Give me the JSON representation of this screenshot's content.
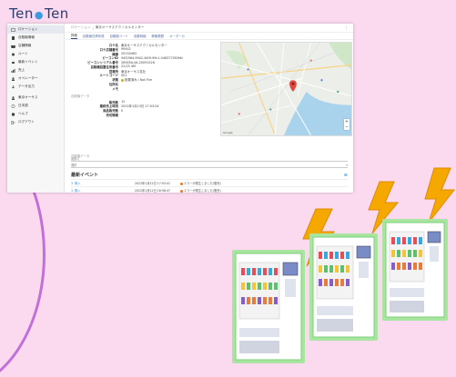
{
  "brand": {
    "logo_left": "Ten",
    "logo_dot": "●",
    "logo_right": "Ten"
  },
  "sidebar": {
    "items": [
      {
        "label": "ロケーション",
        "icon": "building-icon",
        "active": true
      },
      {
        "label": "自販機情報",
        "icon": "vending-icon"
      },
      {
        "label": "店舗情報",
        "icon": "store-icon"
      },
      {
        "label": "ルート",
        "icon": "route-icon"
      },
      {
        "label": "最新イベント",
        "icon": "bell-icon"
      },
      {
        "label": "売上",
        "icon": "chart-icon"
      },
      {
        "label": "オペレーター",
        "icon": "user-icon"
      },
      {
        "label": "データ出力",
        "icon": "download-icon"
      },
      {
        "label": "東京オーサス",
        "icon": "person-icon"
      },
      {
        "label": "日本語",
        "icon": "globe-icon"
      },
      {
        "label": "ヘルプ",
        "icon": "help-icon"
      },
      {
        "label": "ログアウト",
        "icon": "logout-icon"
      }
    ]
  },
  "topbar": {
    "crumb": "ロケーション",
    "current": "東京オーサステクニカルセンター",
    "more": "⋮"
  },
  "tabs": [
    "詳細",
    "自販機在庫状態",
    "自販機コード",
    "収集明細",
    "稼働履歴",
    "オーダーカ"
  ],
  "details": [
    {
      "k": "ロケ名",
      "v": "東京オーサステクニカルセンター"
    },
    {
      "k": "ロケ店舗番号",
      "v": "99442"
    },
    {
      "k": "機番",
      "v": "20154462"
    },
    {
      "k": "ビーコンID",
      "v": "94f2984-9942-44f9-99c1-0463770f296c"
    },
    {
      "k": "ビーコンシリアル番号",
      "v": "285EEA-VA-20091526"
    },
    {
      "k": "自販機設置住所番号",
      "v": "22/25 4M"
    },
    {
      "k": "営業所",
      "v": "東京オーサス支社"
    },
    {
      "k": "ルートコード",
      "v": "001"
    },
    {
      "k": "状態",
      "v": "設置済み / Not Fire"
    },
    {
      "k": "住所名",
      "v": ""
    },
    {
      "k": "メモ",
      "v": ""
    }
  ],
  "section2_label": "自販機データ",
  "details2": [
    {
      "k": "販売数",
      "v": "12"
    },
    {
      "k": "最終売上時刻",
      "v": "2022年1月13日 17:03:24"
    },
    {
      "k": "商品販売数",
      "v": "0"
    },
    {
      "k": "売切情報",
      "v": ""
    }
  ],
  "select_label": "自販機データ",
  "select_value": "品揃え",
  "select_value2": "選択",
  "map": {
    "attribution": "Google",
    "zoom_in": "+",
    "zoom_out": "−"
  },
  "events": {
    "title": "最新イベント",
    "menu_icon": "≡",
    "rows": [
      {
        "name": "3. 購入",
        "time": "2022年1月12日 17:03:41",
        "detail": "エラーが発生しました(販売)"
      },
      {
        "name": "3. 購入",
        "time": "2022年1月12日 16:58:47",
        "detail": "エラーが発生しました(販売)"
      }
    ]
  },
  "colors": {
    "bg": "#fbd9ef",
    "navy": "#2b3e70",
    "accent": "#3a8fd8",
    "vm_body": "#ffffff",
    "vm_trim": "#a8e6a0",
    "bolt": "#f5a800"
  }
}
